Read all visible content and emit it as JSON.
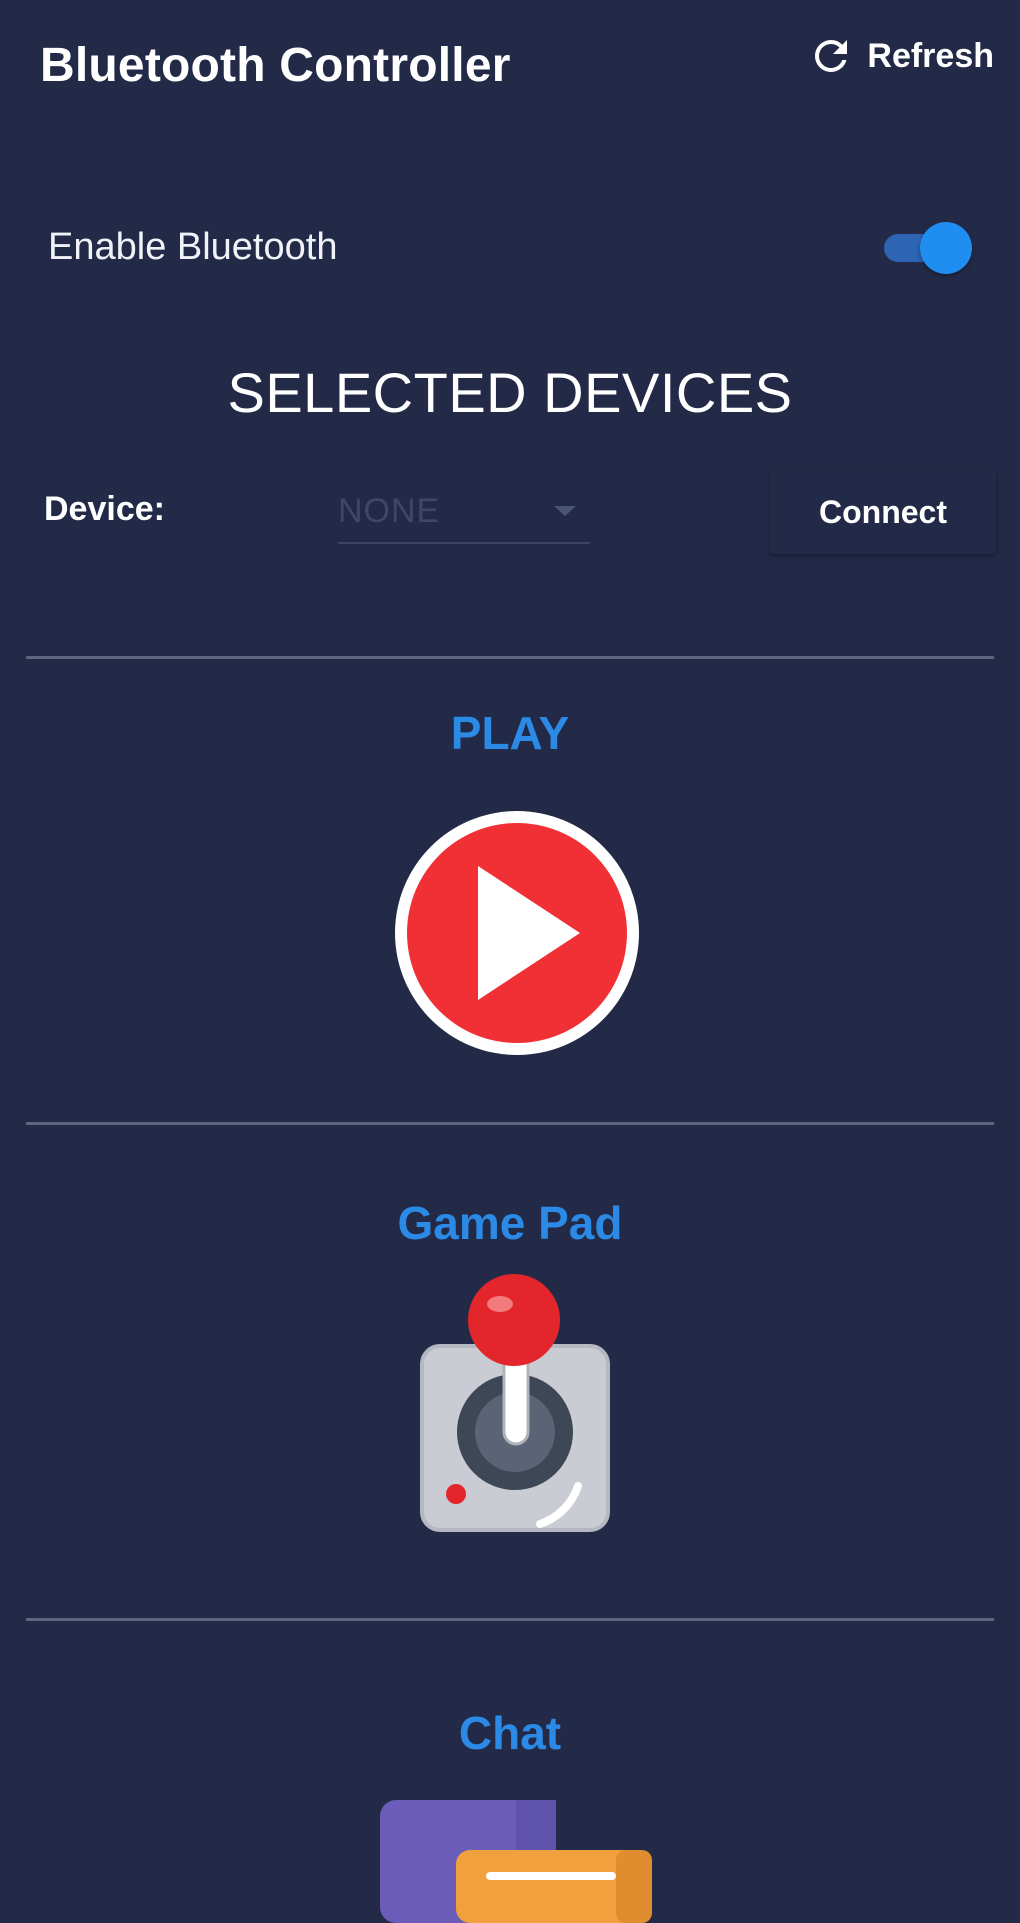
{
  "app_bar": {
    "title": "Bluetooth Controller",
    "refresh_label": "Refresh",
    "refresh_icon": "refresh-icon"
  },
  "bluetooth": {
    "label": "Enable Bluetooth",
    "enabled": true
  },
  "devices": {
    "section_title": "SELECTED DEVICES",
    "device_label": "Device:",
    "selected_value": "NONE",
    "connect_label": "Connect"
  },
  "features": {
    "play": {
      "title": "PLAY",
      "icon": "play-icon"
    },
    "gamepad": {
      "title": "Game Pad",
      "icon": "joystick-icon"
    },
    "chat": {
      "title": "Chat",
      "icon": "chat-icon"
    }
  },
  "colors": {
    "background": "#232a48",
    "accent_blue": "#2b8ae6",
    "toggle_thumb": "#1f8ef0",
    "play_red": "#f03035"
  }
}
